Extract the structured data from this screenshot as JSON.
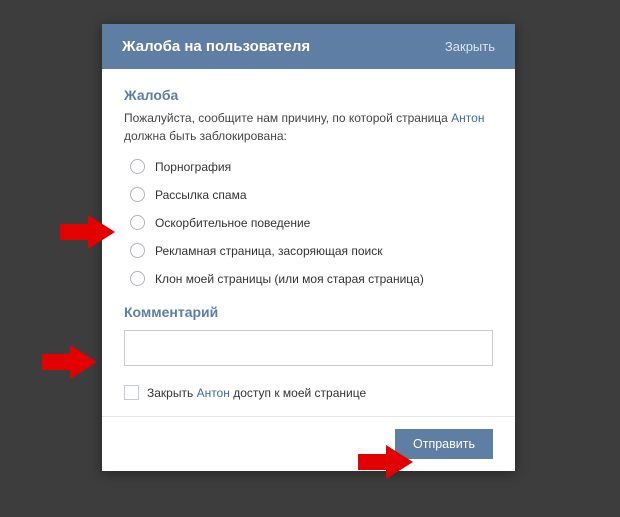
{
  "dialog": {
    "title": "Жалоба на пользователя",
    "close_label": "Закрыть"
  },
  "report": {
    "section_title": "Жалоба",
    "intro_before": "Пожалуйста, сообщите нам причину, по которой страница ",
    "user_name": "Антон",
    "intro_after": " должна быть заблокирована:",
    "options": [
      "Порнография",
      "Рассылка спама",
      "Оскорбительное поведение",
      "Рекламная страница, засоряющая поиск",
      "Клон моей страницы (или моя старая страница)"
    ]
  },
  "comment": {
    "title": "Комментарий",
    "value": ""
  },
  "block_access": {
    "label_before": "Закрыть ",
    "user_name": "Антон",
    "label_after": " доступ к моей странице"
  },
  "footer": {
    "submit_label": "Отправить"
  }
}
